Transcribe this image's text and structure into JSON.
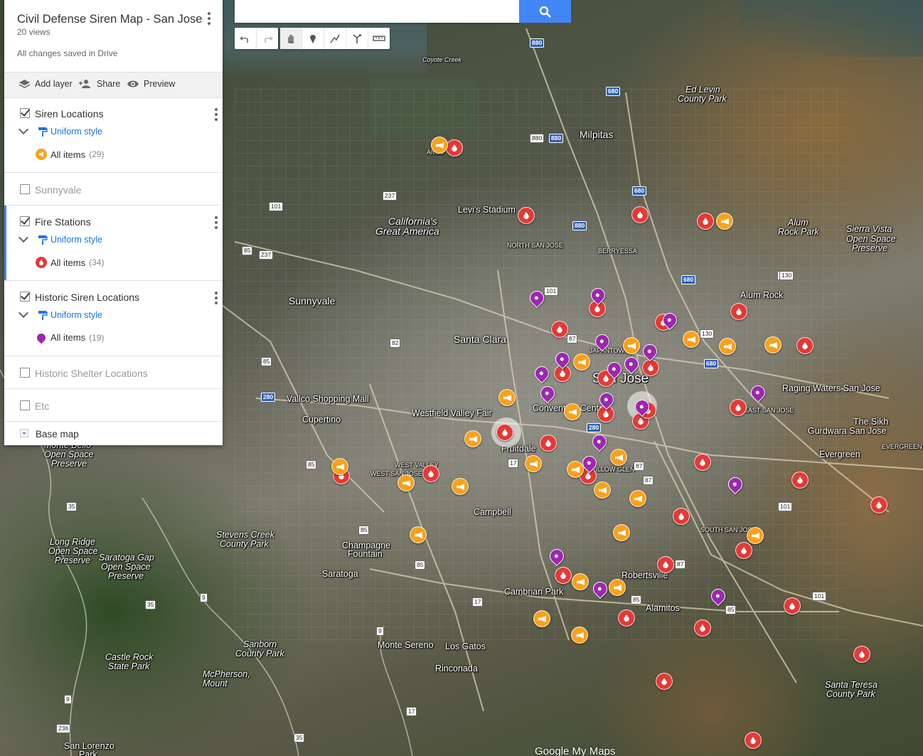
{
  "search": {
    "placeholder": "",
    "value": ""
  },
  "map_info": {
    "title": "Civil Defense Siren Map - San Jose",
    "views": "20 views",
    "save_status": "All changes saved in Drive"
  },
  "actions": {
    "add_layer": "Add layer",
    "share": "Share",
    "preview": "Preview"
  },
  "layers": [
    {
      "name": "Siren Locations",
      "checked": true,
      "style": "Uniform style",
      "items_label": "All items",
      "count": "(29)",
      "icon": "siren-icon"
    },
    {
      "name": "Sunnyvale",
      "checked": false
    },
    {
      "name": "Fire Stations",
      "checked": true,
      "style": "Uniform style",
      "items_label": "All items",
      "count": "(34)",
      "icon": "fire-icon"
    },
    {
      "name": "Historic Siren Locations",
      "checked": true,
      "style": "Uniform style",
      "items_label": "All items",
      "count": "(19)",
      "icon": "pin-icon"
    },
    {
      "name": "Historic Shelter Locations",
      "checked": false
    },
    {
      "name": "Etc",
      "checked": false
    }
  ],
  "base_map": "Base map",
  "toolbar": [
    "undo-icon",
    "redo-icon",
    "hand-icon",
    "add-marker-icon",
    "draw-line-icon",
    "directions-icon",
    "measure-icon"
  ],
  "colors": {
    "fire": "#e53935",
    "siren": "#f9a11b",
    "historic": "#9c27b0",
    "accent": "#4285f4"
  },
  "places": [
    {
      "t": "Milpitas"
    },
    {
      "t": "Levi's Stadium"
    },
    {
      "t": "California's"
    },
    {
      "t": "Great America"
    },
    {
      "t": "NORTH SAN JOSE"
    },
    {
      "t": "BERRYESSA"
    },
    {
      "t": "Ed Levin"
    },
    {
      "t": "County Park"
    },
    {
      "t": "Alum"
    },
    {
      "t": "Rock Park"
    },
    {
      "t": "Sierra Vista"
    },
    {
      "t": "Open Space"
    },
    {
      "t": "Preserve"
    },
    {
      "t": "Alum Rock"
    },
    {
      "t": "Sunnyvale"
    },
    {
      "t": "Santa Clara"
    },
    {
      "t": "San Jose"
    },
    {
      "t": "Vallco Shopping Mall"
    },
    {
      "t": "Westfield Valley Fair"
    },
    {
      "t": "Cupertino"
    },
    {
      "t": "Raging Waters San Jose"
    },
    {
      "t": "EAST SAN JOSE"
    },
    {
      "t": "The Sikh"
    },
    {
      "t": "Gurdwara San Jose"
    },
    {
      "t": "Evergreen"
    },
    {
      "t": "EVERGREEN"
    },
    {
      "t": "Fruitdale"
    },
    {
      "t": "WEST VALLEY"
    },
    {
      "t": "WEST SAN JOSE"
    },
    {
      "t": "Campbell"
    },
    {
      "t": "WILLOW GLEN"
    },
    {
      "t": "Champagne"
    },
    {
      "t": "Fountain"
    },
    {
      "t": "Saratoga"
    },
    {
      "t": "Stevens Creek"
    },
    {
      "t": "County Park"
    },
    {
      "t": "Long Ridge"
    },
    {
      "t": "Open Space"
    },
    {
      "t": "Preserve"
    },
    {
      "t": "Saratoga Gap"
    },
    {
      "t": "Open Space"
    },
    {
      "t": "Preserve"
    },
    {
      "t": "Monte Bello"
    },
    {
      "t": "Open Space"
    },
    {
      "t": "Preserve"
    },
    {
      "t": "Cambrian Park"
    },
    {
      "t": "Robertsville"
    },
    {
      "t": "Alamitos"
    },
    {
      "t": "SOUTH SAN JOSE"
    },
    {
      "t": "Monte Sereno"
    },
    {
      "t": "Los Gatos"
    },
    {
      "t": "Rinconada"
    },
    {
      "t": "Sanborn"
    },
    {
      "t": "County Park"
    },
    {
      "t": "Castle Rock"
    },
    {
      "t": "State Park"
    },
    {
      "t": "McPherson,"
    },
    {
      "t": "Mount"
    },
    {
      "t": "Santa Teresa"
    },
    {
      "t": "County Park"
    },
    {
      "t": "San Lorenzo"
    },
    {
      "t": "Park"
    },
    {
      "t": "Convention Center"
    },
    {
      "t": "JAPANTOWN"
    },
    {
      "t": "Coyote Creek"
    },
    {
      "t": "Alviso"
    }
  ],
  "shields": [
    "880",
    "880",
    "680",
    "680",
    "680",
    "680",
    "880",
    "880",
    "237",
    "101",
    "101",
    "85",
    "237",
    "101",
    "87",
    "82",
    "85",
    "280",
    "280",
    "87",
    "87",
    "17",
    "85",
    "101",
    "101",
    "85",
    "17",
    "85",
    "87",
    "85",
    "85",
    "9",
    "9",
    "9",
    "35",
    "35",
    "35",
    "236",
    "17",
    "130",
    "130"
  ],
  "logo": "Google My Maps"
}
